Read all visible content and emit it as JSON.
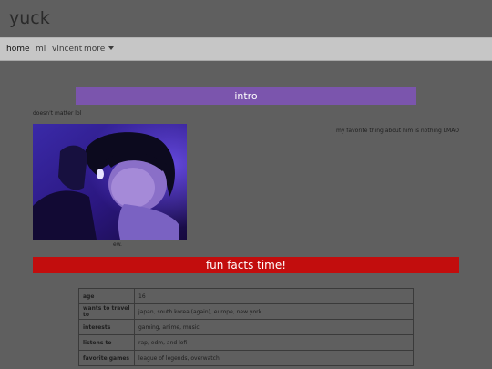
{
  "site": {
    "title": "yuck"
  },
  "nav": {
    "items": [
      "home",
      "mi",
      "vincent",
      "more"
    ]
  },
  "intro": {
    "heading": "intro",
    "subtitle": "doesn't matter lol",
    "side_note": "my favorite thing about him is nothing LMAO",
    "caption": "ew."
  },
  "facts": {
    "heading": "fun facts time!",
    "rows": [
      {
        "label": "age",
        "value": "16"
      },
      {
        "label": "wants to travel to",
        "value": "japan, south korea (again), europe, new york"
      },
      {
        "label": "interests",
        "value": "gaming, anime, music"
      },
      {
        "label": "listens to",
        "value": "rap, edm, and lofi"
      },
      {
        "label": "favorite games",
        "value": "league of legends, overwatch"
      }
    ]
  },
  "colors": {
    "background": "#5f5f5f",
    "navbar": "#c6c6c6",
    "intro_bar": "#7b55ad",
    "facts_bar": "#c20d0d"
  }
}
